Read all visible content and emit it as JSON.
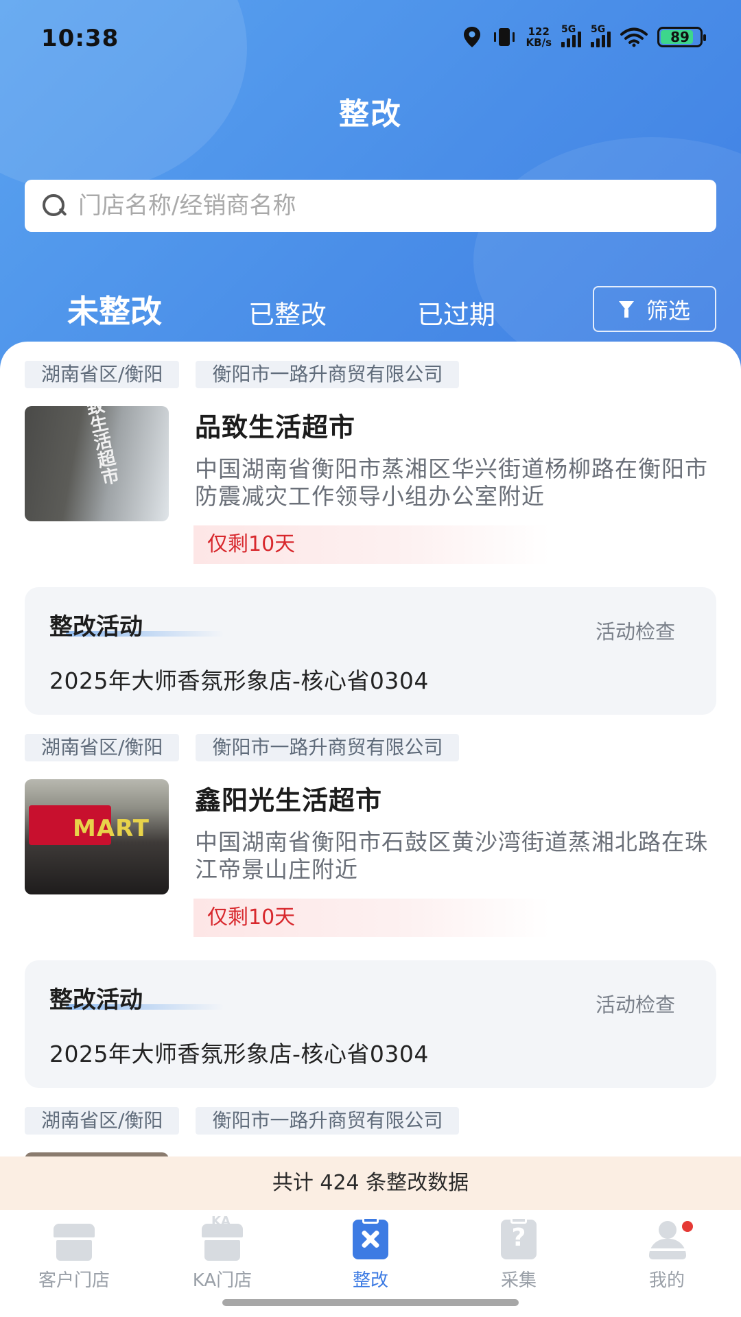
{
  "status_bar": {
    "time": "10:38",
    "speed_value": "122",
    "speed_unit": "KB/s",
    "signal1": "5G",
    "signal2": "5G",
    "battery": "89",
    "icons": [
      "location-icon",
      "vibrate-icon",
      "wifi-icon",
      "battery-icon"
    ]
  },
  "header": {
    "title": "整改"
  },
  "search": {
    "placeholder": "门店名称/经销商名称"
  },
  "tabs": [
    {
      "label": "未整改",
      "active": true
    },
    {
      "label": "已整改",
      "active": false
    },
    {
      "label": "已过期",
      "active": false
    }
  ],
  "filter": {
    "label": "筛选"
  },
  "cards": [
    {
      "region": "湖南省区/衡阳",
      "dealer": "衡阳市一路升商贸有限公司",
      "store_name": "品致生活超市",
      "thumb_text": "致生活超市",
      "address": "中国湖南省衡阳市蒸湘区华兴街道杨柳路在衡阳市防震减灾工作领导小组办公室附近",
      "deadline": "仅剩10天",
      "activity_title": "整改活动",
      "activity_action": "活动检查",
      "activity_desc": "2025年大师香氛形象店-核心省0304"
    },
    {
      "region": "湖南省区/衡阳",
      "dealer": "衡阳市一路升商贸有限公司",
      "store_name": "鑫阳光生活超市",
      "thumb_text": "MART",
      "address": "中国湖南省衡阳市石鼓区黄沙湾街道蒸湘北路在珠江帝景山庄附近",
      "deadline": "仅剩10天",
      "activity_title": "整改活动",
      "activity_action": "活动检查",
      "activity_desc": "2025年大师香氛形象店-核心省0304"
    },
    {
      "region": "湖南省区/衡阳",
      "dealer": "衡阳市一路升商贸有限公司"
    }
  ],
  "total_text": "共计 424 条整改数据",
  "bottom_nav": [
    {
      "label": "客户门店",
      "icon": "store-icon",
      "active": false
    },
    {
      "label": "KA门店",
      "icon": "ka-store-icon",
      "active": false
    },
    {
      "label": "整改",
      "icon": "rectify-icon",
      "active": true
    },
    {
      "label": "采集",
      "icon": "collect-icon",
      "active": false
    },
    {
      "label": "我的",
      "icon": "profile-icon",
      "active": false
    }
  ],
  "colors": {
    "header_gradient_start": "#5aa3f0",
    "header_gradient_end": "#3f7fe3",
    "accent": "#3d7be3",
    "deadline_red": "#d8282d",
    "total_bar_bg": "#fbeee3"
  }
}
